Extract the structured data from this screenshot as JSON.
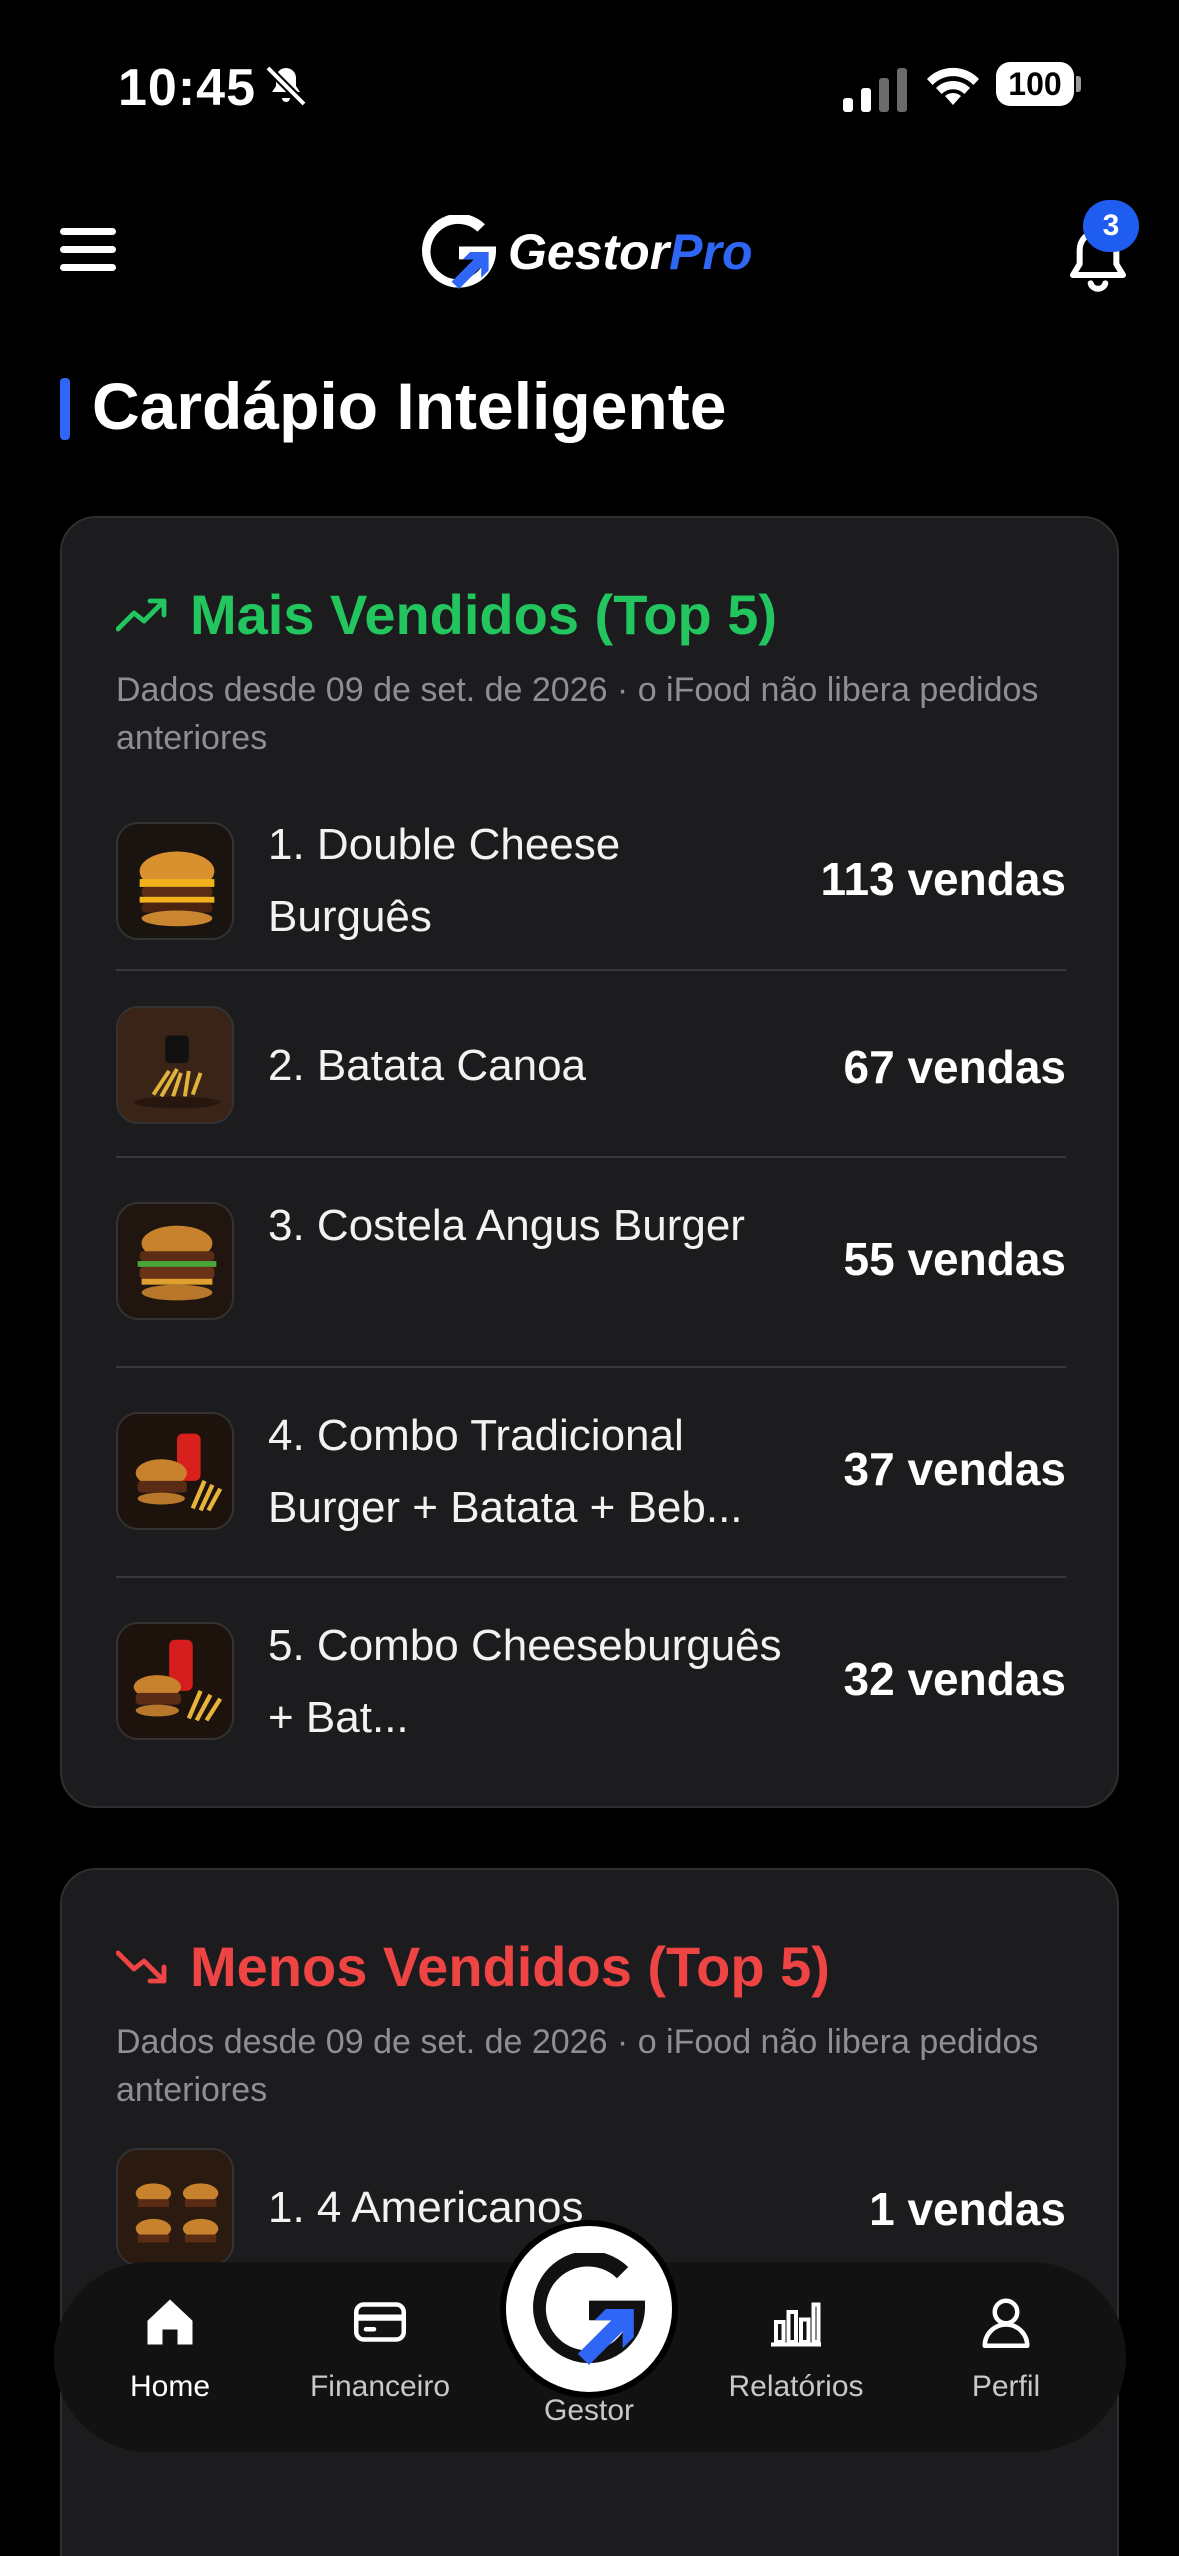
{
  "status_bar": {
    "time": "10:45",
    "battery": "100"
  },
  "header": {
    "brand": "Gestor",
    "brand_accent": "Pro",
    "notification_count": "3"
  },
  "page": {
    "title": "Cardápio Inteligente"
  },
  "best_sellers": {
    "title": "Mais Vendidos (Top 5)",
    "subtitle": "Dados desde 09 de set. de 2026 · o iFood não libera pedidos anteriores",
    "items": [
      {
        "name": "1. Double Cheese Burguês",
        "sales": "113 vendas"
      },
      {
        "name": "2. Batata Canoa",
        "sales": "67 vendas"
      },
      {
        "name": "3. Costela Angus Burger",
        "sales": "55 vendas"
      },
      {
        "name": "4. Combo Tradicional Burger + Batata + Beb...",
        "sales": "37 vendas"
      },
      {
        "name": "5. Combo Cheeseburguês + Bat...",
        "sales": "32 vendas"
      }
    ]
  },
  "least_sellers": {
    "title": "Menos Vendidos (Top 5)",
    "subtitle": "Dados desde 09 de set. de 2026 · o iFood não libera pedidos anteriores",
    "items": [
      {
        "name": "1. 4 Americanos",
        "sales": "1 vendas"
      }
    ]
  },
  "tabbar": {
    "home": "Home",
    "financeiro": "Financeiro",
    "gestor": "Gestor",
    "relatorios": "Relatórios",
    "perfil": "Perfil"
  },
  "colors": {
    "accent": "#2f66f5",
    "positive": "#22c55e",
    "negative": "#ef4444",
    "card": "#1c1c1e"
  }
}
